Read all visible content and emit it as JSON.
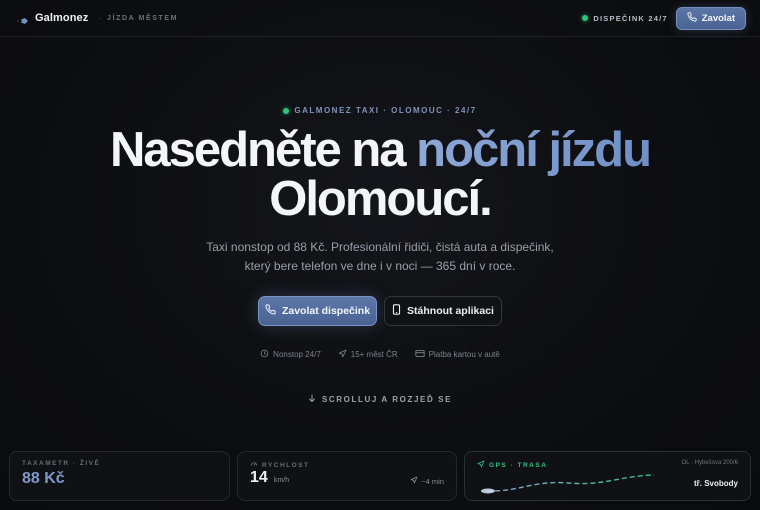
{
  "header": {
    "brand": "Galmonez",
    "separator": "·",
    "tagline": "JÍZDA MĚSTEM",
    "status": "DISPEČINK 24/7",
    "call_button": "Zavolat"
  },
  "hero": {
    "eyebrow": "GALMONEZ TAXI · OLOMOUC · 24/7",
    "headline_part1": "Nasedněte na ",
    "headline_accent": "noční jízdu",
    "headline_line2": "Olomoucí.",
    "subtitle_line1": "Taxi nonstop od 88 Kč. Profesionální řidiči, čistá auta a dispečink,",
    "subtitle_line2": "který bere telefon ve dne i v noci — 365 dní v roce.",
    "primary_cta": "Zavolat dispečink",
    "secondary_cta": "Stáhnout aplikaci",
    "features": [
      "Nonstop 24/7",
      "15+ měst ČR",
      "Platba kartou v autě"
    ],
    "scroll_hint": "SCROLLUJ A ROZJEĎ SE"
  },
  "cards": {
    "taximeter": {
      "label": "TAXAMETR · ŽIVĚ",
      "value": "88 Kč"
    },
    "speed": {
      "label": "RYCHLOST",
      "value": "14",
      "unit": "km/h",
      "eta": "~4 min"
    },
    "gps": {
      "label": "GPS · TRASA",
      "address": "OL · Hybešova 200/6",
      "street": "tř. Svobody"
    }
  },
  "colors": {
    "accent": "#8aa4d4",
    "status_green": "#2ec27e",
    "background": "#0d0e11"
  }
}
